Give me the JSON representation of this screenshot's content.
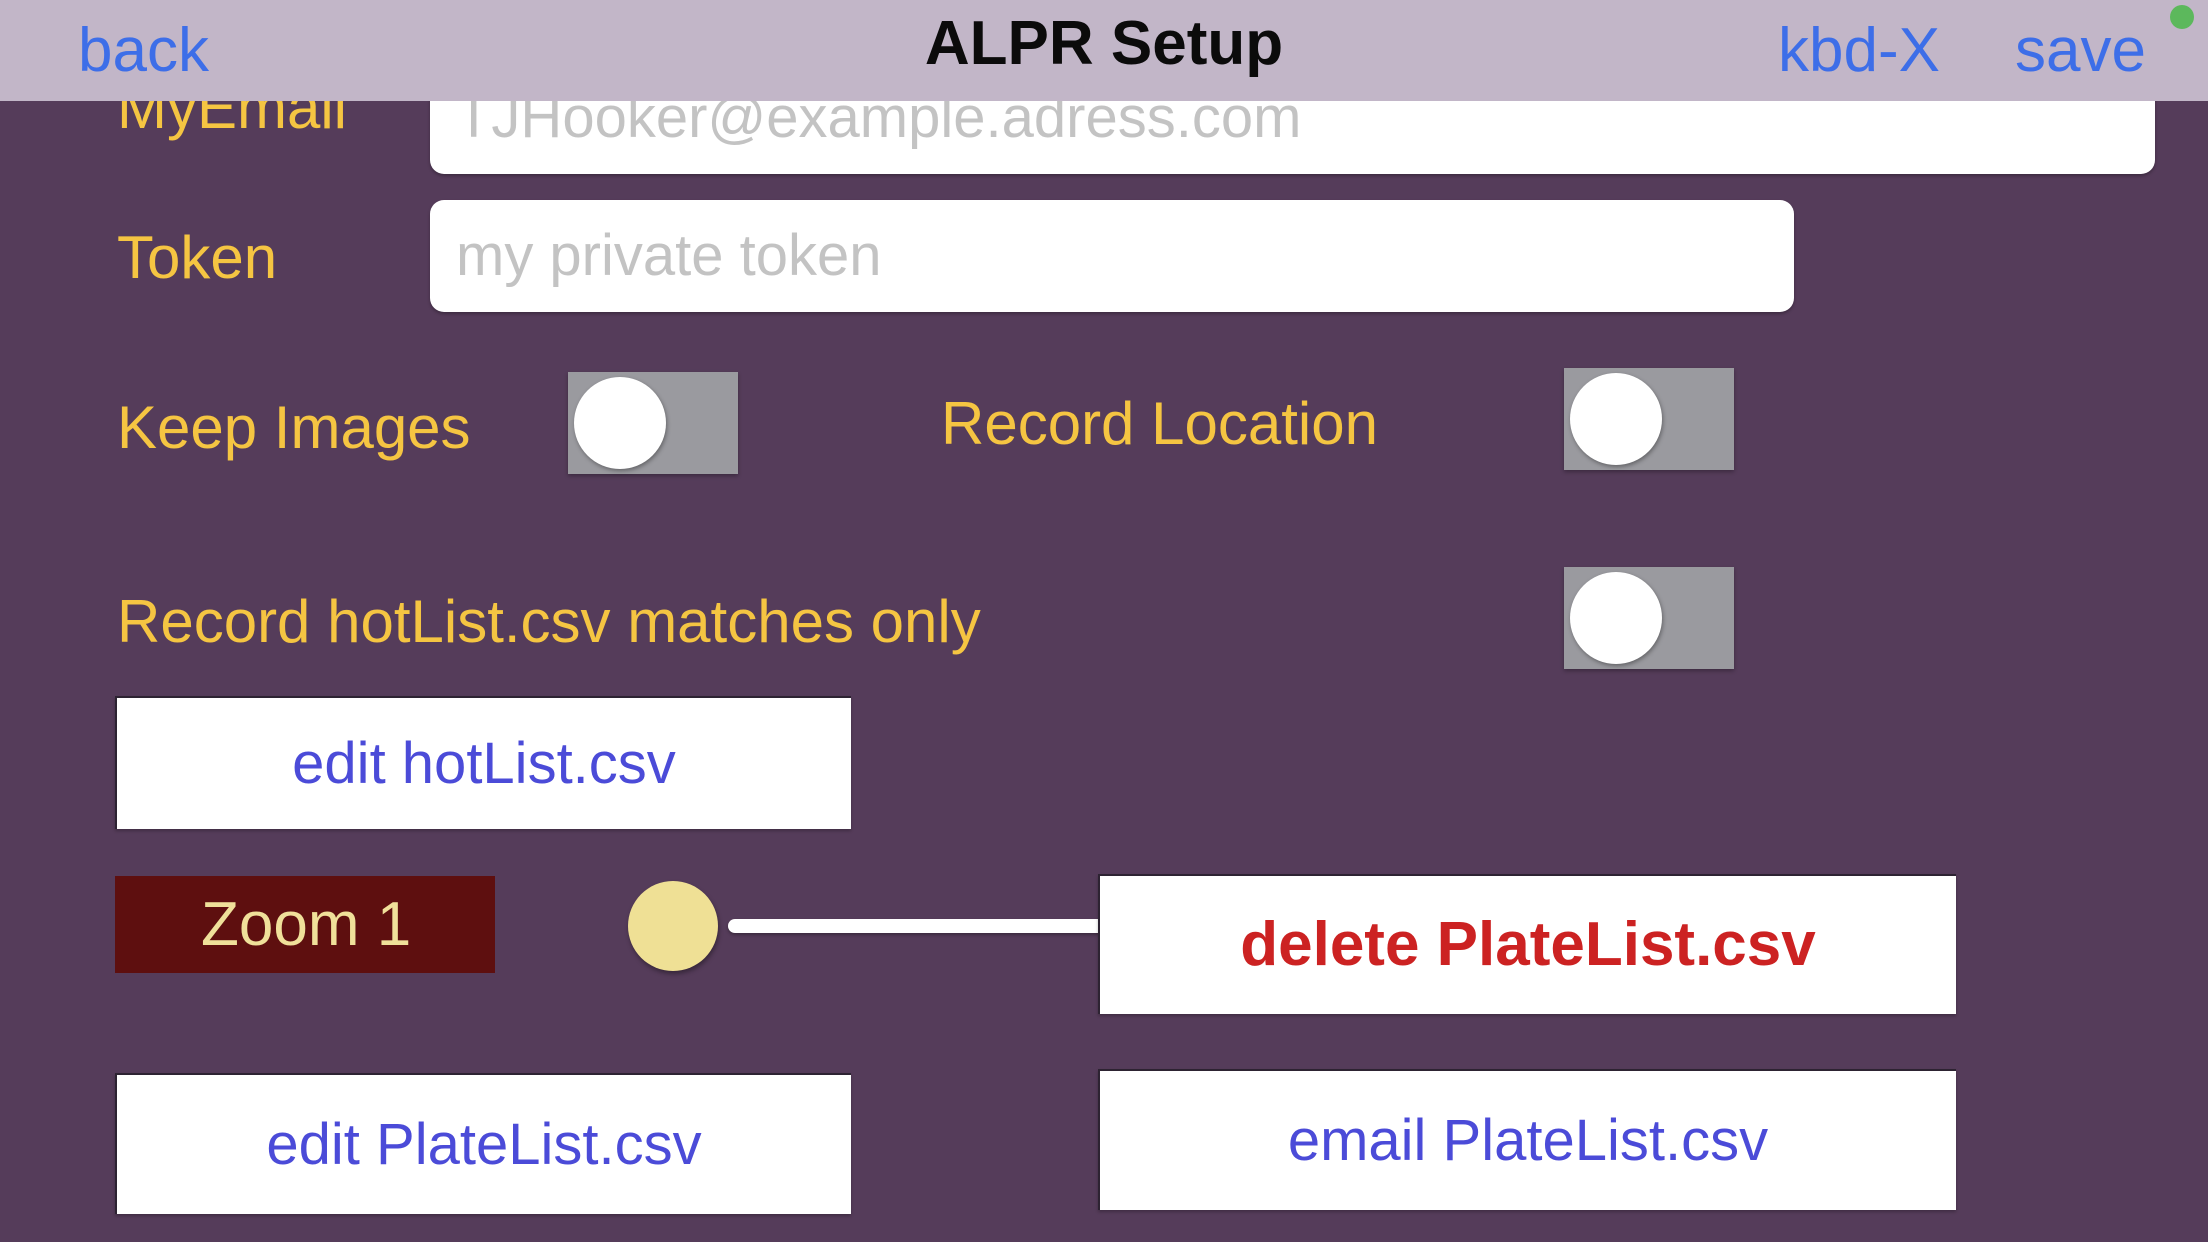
{
  "header": {
    "back_label": "back",
    "title": "ALPR Setup",
    "keyboard_label": "kbd-X",
    "save_label": "save",
    "status_dot_color": "#5cb85c",
    "background_color": "#c2b6c8",
    "link_color": "#3d6ee8"
  },
  "theme": {
    "page_background": "#553c5a",
    "label_color": "#f5c542",
    "button_text_color": "#4b4bd8",
    "danger_text_color": "#cc2222",
    "zoom_button_background": "#5e0f0f",
    "zoom_button_text_color": "#f0e09a",
    "toggle_track_color": "#9a9a9f",
    "toggle_knob_color": "#ffffff",
    "slider_knob_color": "#efe095"
  },
  "form": {
    "email": {
      "label": "MyEmail",
      "value": "",
      "placeholder": "TJHooker@example.adress.com"
    },
    "token": {
      "label": "Token",
      "value": "",
      "placeholder": "my private token"
    }
  },
  "toggles": [
    {
      "label": "Keep Images",
      "state": "off"
    },
    {
      "label": "Record Location",
      "state": "off"
    },
    {
      "label": "Record hotList.csv matches only",
      "state": "off"
    }
  ],
  "buttons": {
    "edit_hotlist": "edit hotList.csv",
    "delete_platelist": "delete PlateList.csv",
    "edit_platelist": "edit PlateList.csv",
    "email_platelist": "email PlateList.csv"
  },
  "zoom": {
    "button_label": "Zoom 1",
    "value": 1,
    "slider_position_percent": 0
  }
}
